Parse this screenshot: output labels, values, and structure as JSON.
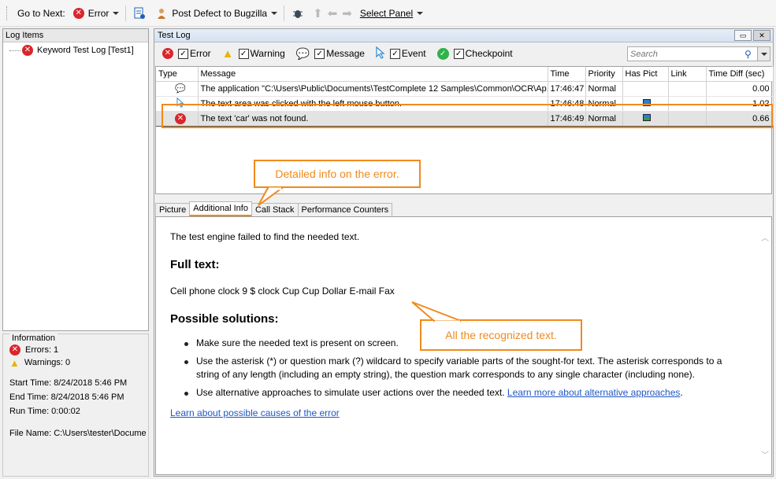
{
  "toolbar": {
    "go_to_next_label": "Go to Next:",
    "error_label": "Error",
    "post_defect_label": "Post Defect to Bugzilla",
    "select_panel_label": "Select Panel"
  },
  "log_items": {
    "title": "Log Items",
    "items": [
      {
        "label": "Keyword Test Log [Test1]"
      }
    ]
  },
  "information": {
    "title": "Information",
    "errors": "Errors: 1",
    "warnings": "Warnings: 0",
    "start_time": "Start Time: 8/24/2018 5:46 PM",
    "end_time": "End Time: 8/24/2018 5:46 PM",
    "run_time": "Run Time: 0:00:02",
    "file_name": "File Name: C:\\Users\\tester\\Docume"
  },
  "test_log": {
    "title": "Test Log",
    "filters": [
      {
        "label": "Error",
        "icon": "error-icon",
        "checked": true
      },
      {
        "label": "Warning",
        "icon": "warning-icon",
        "checked": true
      },
      {
        "label": "Message",
        "icon": "message-icon",
        "checked": true
      },
      {
        "label": "Event",
        "icon": "event-icon",
        "checked": true
      },
      {
        "label": "Checkpoint",
        "icon": "checkpoint-icon",
        "checked": true
      }
    ],
    "search_placeholder": "Search",
    "columns": [
      "Type",
      "Message",
      "Time",
      "Priority",
      "Has Pict",
      "Link",
      "Time Diff (sec)"
    ],
    "rows": [
      {
        "type_icon": "message-icon",
        "message": "The application \"C:\\Users\\Public\\Documents\\TestComplete 12 Samples\\Common\\OCR\\Ap...",
        "time": "17:46:47",
        "priority": "Normal",
        "has_pict": false,
        "link": "",
        "diff": "0.00"
      },
      {
        "type_icon": "event-icon",
        "message": "The text area was clicked with the left mouse button.",
        "time": "17:46:48",
        "priority": "Normal",
        "has_pict": true,
        "link": "",
        "diff": "1.02"
      },
      {
        "type_icon": "error-icon",
        "message": "The text 'car' was not found.",
        "time": "17:46:49",
        "priority": "Normal",
        "has_pict": true,
        "link": "",
        "diff": "0.66",
        "selected": true
      }
    ],
    "tabs": [
      "Picture",
      "Additional Info",
      "Call Stack",
      "Performance Counters"
    ],
    "active_tab": "Additional Info"
  },
  "details": {
    "intro": "The test engine failed to find the needed text.",
    "full_text_heading": "Full text:",
    "full_text": "Cell phone clock 9 $ clock Cup Cup Dollar E-mail Fax",
    "solutions_heading": "Possible solutions:",
    "solution_1": "Make sure the needed text is present on screen.",
    "solution_2": "Use the asterisk (*) or question mark (?) wildcard to specify variable parts of the sought-for text. The asterisk corresponds to a string of any length (including an empty string), the question mark corresponds to any single character (including none).",
    "solution_3_text": "Use alternative approaches to simulate user actions over the needed text.",
    "solution_3_link": "Learn more about alternative approaches",
    "solution_3_end": ".",
    "causes_link": "Learn about possible causes of the error"
  },
  "callouts": {
    "detailed_info": "Detailed info on the error.",
    "recognized_text": "All the recognized text."
  },
  "colors": {
    "accent": "#f08a1c",
    "error": "#d9262c",
    "link": "#1f57c3"
  }
}
